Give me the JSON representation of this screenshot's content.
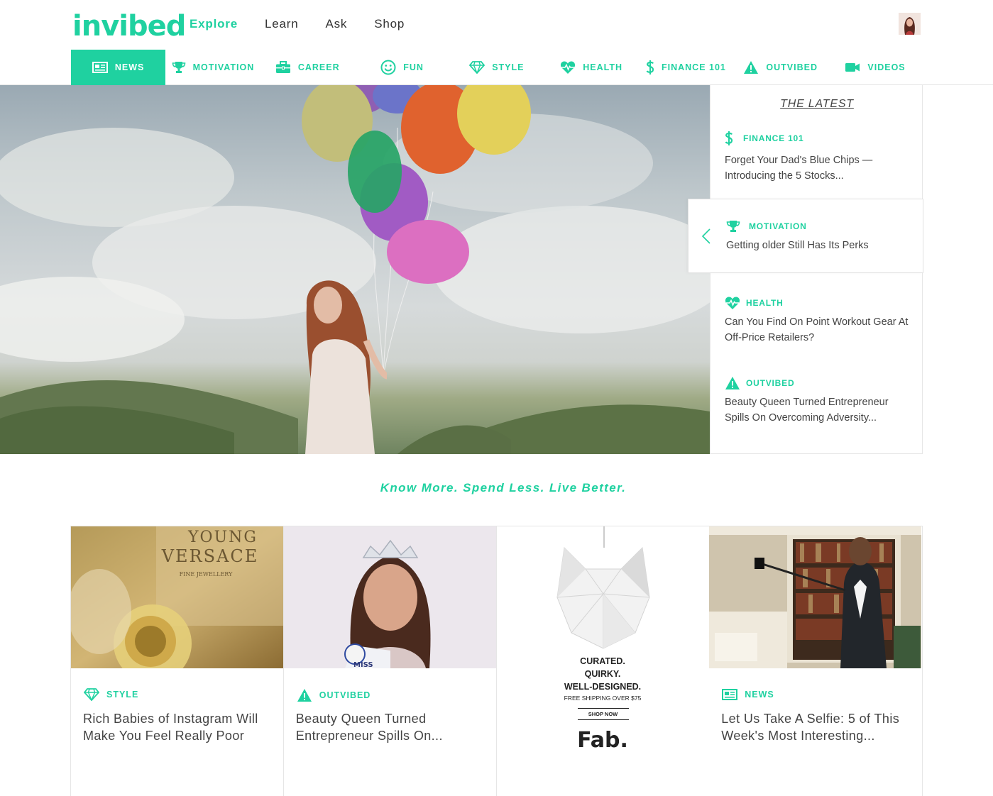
{
  "brand": {
    "logo": "invibed",
    "accent": "#1fd1a0"
  },
  "topnav": [
    "Explore",
    "Learn",
    "Ask",
    "Shop"
  ],
  "categories": [
    "NEWS",
    "MOTIVATION",
    "CAREER",
    "FUN",
    "STYLE",
    "HEALTH",
    "FINANCE 101",
    "OUTVIBED",
    "VIDEOS"
  ],
  "latest": {
    "title": "THE LATEST",
    "items": [
      {
        "category": "FINANCE 101",
        "icon": "dollar-icon",
        "text": "Forget Your Dad's Blue Chips — Introducing the 5 Stocks..."
      },
      {
        "category": "MOTIVATION",
        "icon": "trophy-icon",
        "text": "Getting older Still Has Its Perks"
      },
      {
        "category": "HEALTH",
        "icon": "heart-pulse-icon",
        "text": "Can You Find On Point Workout Gear At Off-Price Retailers?"
      },
      {
        "category": "OUTVIBED",
        "icon": "warning-icon",
        "text": "Beauty Queen Turned Entrepreneur Spills On Overcoming Adversity..."
      }
    ]
  },
  "tagline": "Know More. Spend Less. Live Better.",
  "cards": [
    {
      "category": "STYLE",
      "icon": "diamond-icon",
      "title": "Rich Babies of Instagram Will Make You Feel Really Poor",
      "image_text": [
        "YOUNG",
        "VERSACE",
        "FINE JEWELLERY"
      ]
    },
    {
      "category": "OUTVIBED",
      "icon": "warning-icon",
      "title": "Beauty Queen Turned Entrepreneur Spills On...",
      "image_text": [
        "MISS"
      ]
    },
    {
      "category": "NEWS",
      "icon": "newspaper-icon",
      "title": "Let Us Take A Selfie: 5 of This Week's Most Interesting..."
    }
  ],
  "ad": {
    "lines": [
      "CURATED.",
      "QUIRKY.",
      "WELL-DESIGNED."
    ],
    "shipping": "FREE SHIPPING OVER $75",
    "cta": "SHOP NOW",
    "brand": "Fab."
  }
}
